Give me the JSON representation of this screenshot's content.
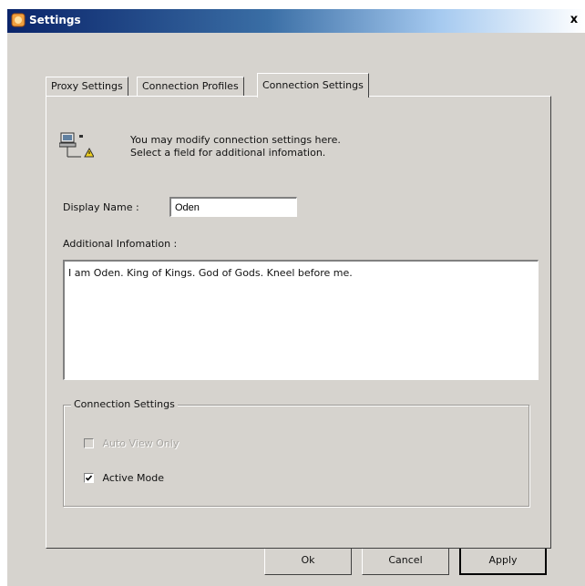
{
  "window": {
    "title": "Settings",
    "close_glyph": "x",
    "accent_color": "#0a246a"
  },
  "tabs": [
    {
      "label": "Proxy Settings",
      "active": false
    },
    {
      "label": "Connection Profiles",
      "active": false
    },
    {
      "label": "Connection Settings",
      "active": true
    }
  ],
  "panel": {
    "icon": "network-computer-warning-icon",
    "description_line1": "You may modify connection settings here.",
    "description_line2": "Select a field for additional infomation.",
    "display_name_label": "Display Name :",
    "display_name_value": "Oden",
    "additional_info_label": "Additional Infomation :",
    "additional_info_value": "I am Oden. King of Kings. God of Gods. Kneel before me.",
    "group_title": "Connection Settings",
    "auto_view_only_label": "Auto View Only",
    "auto_view_only_checked": false,
    "auto_view_only_disabled": true,
    "active_mode_label": "Active Mode",
    "active_mode_checked": true
  },
  "buttons": {
    "ok": "Ok",
    "cancel": "Cancel",
    "apply": "Apply"
  }
}
